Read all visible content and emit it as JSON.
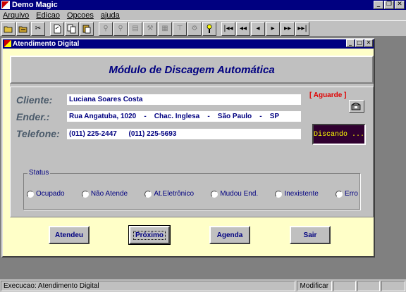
{
  "window": {
    "title": "Demo Magic"
  },
  "menu": [
    "Arquivo",
    "Edicao",
    "Opcoes",
    "ajuda"
  ],
  "toolbar": {
    "buttons": [
      "open-folder",
      "save-folder",
      "cut",
      "new-doc",
      "copy",
      "paste",
      "search",
      "search-next",
      "list",
      "wrench",
      "table",
      "tree",
      "tools",
      "help",
      "first",
      "prev-page",
      "prev",
      "next",
      "next-page",
      "last"
    ]
  },
  "child": {
    "title": "Atendimento Digital"
  },
  "form": {
    "heading": "Módulo de Discagem Automática",
    "cliente_label": "Cliente:",
    "cliente_value": "Luciana Soares Costa",
    "ender_label": "Ender.:",
    "ender_value": "Rua Angatuba, 1020    -    Chac. Inglesa    -    São Paulo    -    SP",
    "telefone_label": "Telefone:",
    "telefone_value": "(011) 225-2447      (011) 225-5693",
    "aguarde": "[ Aguarde ]",
    "dialing": "Discando ..."
  },
  "status": {
    "legend": "Status",
    "options": [
      "Ocupado",
      "Não Atende",
      "At.Eletrônico",
      "Mudou End.",
      "Inexistente",
      "Erro"
    ]
  },
  "actions": {
    "atendeu": "Atendeu",
    "proximo": "Próximo",
    "agenda": "Agenda",
    "sair": "Sair"
  },
  "statusbar": {
    "message": "Execucao: Atendimento Digital",
    "mode": "Modificar"
  },
  "colors": {
    "title_bar": "#000080",
    "content_bg": "#ffffc8",
    "field_text": "#000080",
    "label_text": "#4a5a6a",
    "alert": "#e00000"
  }
}
